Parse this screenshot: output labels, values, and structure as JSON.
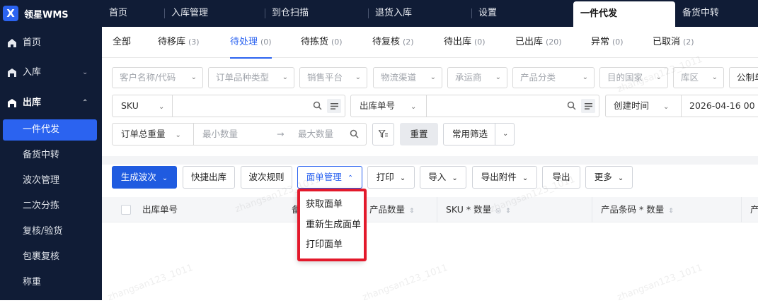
{
  "app": {
    "logo_mark": "X",
    "title": "领星WMS"
  },
  "topnav": [
    {
      "label": "首页"
    },
    {
      "label": "入库管理"
    },
    {
      "label": "到仓扫描"
    },
    {
      "label": "退货入库"
    },
    {
      "label": "设置"
    },
    {
      "label": "一件代发",
      "active": true
    },
    {
      "label": "备货中转"
    }
  ],
  "sidebar": {
    "groups": [
      {
        "label": "首页",
        "icon": "home-icon"
      },
      {
        "label": "入库",
        "icon": "inbound-icon",
        "caret": "chevron-down-icon"
      },
      {
        "label": "出库",
        "icon": "outbound-icon",
        "caret": "chevron-up-icon"
      }
    ],
    "subitems": [
      {
        "label": "一件代发",
        "active": true
      },
      {
        "label": "备货中转"
      },
      {
        "label": "波次管理"
      },
      {
        "label": "二次分拣"
      },
      {
        "label": "复核/验货"
      },
      {
        "label": "包裹复核"
      },
      {
        "label": "称重"
      }
    ]
  },
  "status_tabs": [
    {
      "label": "全部",
      "count": ""
    },
    {
      "label": "待移库",
      "count": "(3)"
    },
    {
      "label": "待处理",
      "count": "(0)",
      "active": true
    },
    {
      "label": "待拣货",
      "count": "(0)"
    },
    {
      "label": "待复核",
      "count": "(2)"
    },
    {
      "label": "待出库",
      "count": "(0)"
    },
    {
      "label": "已出库",
      "count": "(20)"
    },
    {
      "label": "异常",
      "count": "(0)"
    },
    {
      "label": "已取消",
      "count": "(2)"
    }
  ],
  "filters": {
    "row1": [
      "客户名称/代码",
      "订单品种类型",
      "销售平台",
      "物流渠道",
      "承运商",
      "产品分类",
      "目的国家",
      "库区",
      "公制单位"
    ],
    "sku_select": "SKU",
    "order_no_select": "出库单号",
    "time_select": "创建时间",
    "date_value": "2026-04-16 00",
    "weight_select": "订单总重量",
    "min_placeholder": "最小数量",
    "arrow": "→",
    "max_placeholder": "最大数量",
    "reset_label": "重置",
    "common_filter_label": "常用筛选"
  },
  "toolbar": {
    "generate_wave": "生成波次",
    "quick_outbound": "快捷出库",
    "wave_rules": "波次规则",
    "waybill_mgmt": "面单管理",
    "print": "打印",
    "import": "导入",
    "export_attachment": "导出附件",
    "export": "导出",
    "more": "更多"
  },
  "waybill_menu": [
    "获取面单",
    "重新生成面单",
    "打印面单"
  ],
  "table": {
    "columns": [
      "出库单号",
      "备",
      "产品数量",
      "SKU * 数量",
      "产品条码 * 数量",
      "产"
    ]
  },
  "colors": {
    "accent": "#2b63f0",
    "highlight": "#e3192b",
    "nav_bg": "#101c36"
  },
  "watermark": "zhangsan123_1011"
}
